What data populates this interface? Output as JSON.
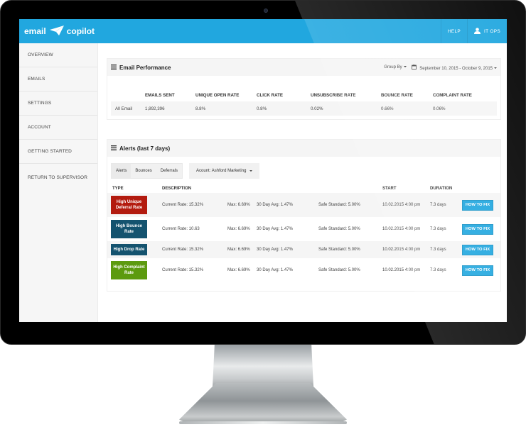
{
  "app": {
    "logo_left": "email",
    "logo_right": "copilot",
    "logo_icon": "paper-plane-icon",
    "brand_color": "#21a7df"
  },
  "topbar": {
    "help_label": "HELP",
    "user_label": "IT OPS",
    "user_icon": "user-icon"
  },
  "sidebar": {
    "items": [
      {
        "label": "OVERVIEW"
      },
      {
        "label": "EMAILS"
      },
      {
        "label": "SETTINGS"
      },
      {
        "label": "ACCOUNT"
      },
      {
        "label": "GETTING STARTED"
      },
      {
        "label": "RETURN TO SUPERVISOR"
      }
    ]
  },
  "performance": {
    "title": "Email Performance",
    "group_by_label": "Group By",
    "date_range": "September 10, 2015 - October 9, 2015",
    "columns": [
      "",
      "EMAILS SENT",
      "UNIQUE OPEN RATE",
      "CLICK RATE",
      "UNSUBSCRIBE RATE",
      "BOUNCE RATE",
      "COMPLAINT RATE"
    ],
    "rows": [
      [
        "All Email",
        "1,892,396",
        "8.8%",
        "0.8%",
        "0.02%",
        "0.66%",
        "0.06%"
      ]
    ]
  },
  "alerts": {
    "title": "Alerts (last 7 days)",
    "tabs": [
      {
        "label": "Alerts"
      },
      {
        "label": "Bounces"
      },
      {
        "label": "Deferrals"
      }
    ],
    "account_select": "Acount: Ashford Marketing",
    "columns": {
      "type": "TYPE",
      "description": "DESCRIPTION",
      "start": "START",
      "duration": "DURATION"
    },
    "rows": [
      {
        "type": "High Unique Deferral Rate",
        "color": "#b31b0f",
        "current": "Current Rate: 15.32%",
        "max": "Max: 6.69%",
        "avg": "30 Day Avg: 1.47%",
        "safe": "Safe Standard: 5.00%",
        "start": "10.02.2015 4:00 pm",
        "duration": "7.3 days",
        "action": "HOW TO FIX"
      },
      {
        "type": "High Bounce Rate",
        "color": "#14536f",
        "current": "Current Rate: 10.63",
        "max": "Max: 6.69%",
        "avg": "30 Day Avg: 1.47%",
        "safe": "Safe Standard: 5.00%",
        "start": "10.02.2015 4:00 pm",
        "duration": "7.3 days",
        "action": "HOW TO FIX"
      },
      {
        "type": "High Drop Rate",
        "color": "#14536f",
        "current": "Current Rate: 15.32%",
        "max": "Max: 6.69%",
        "avg": "30 Day Avg: 1.47%",
        "safe": "Safe Standard: 5.00%",
        "start": "10.02.2015 4:00 pm",
        "duration": "7.3 days",
        "action": "HOW TO FIX"
      },
      {
        "type": "High Complaint Rate",
        "color": "#5c9a0f",
        "current": "Current Rate: 15.32%",
        "max": "Max: 6.69%",
        "avg": "30 Day Avg: 1.47%",
        "safe": "Safe Standard: 5.00%",
        "start": "10.02.2015 4:00 pm",
        "duration": "7.3 days",
        "action": "HOW TO FIX"
      }
    ]
  }
}
